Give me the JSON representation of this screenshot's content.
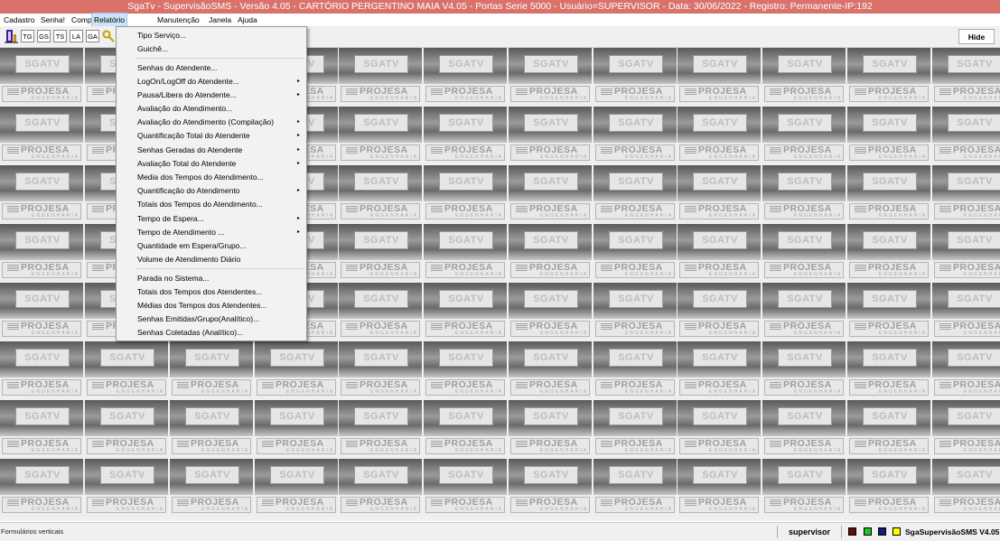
{
  "window": {
    "title": "SgaTv - SupervisãoSMS - Versão 4.05 - CARTÓRIO PERGENTINO MAIA V4.05 - Portas Serie 5000 - Usuário=SUPERVISOR  - Data: 30/06/2022 - Registro: Permanente-IP:192"
  },
  "menubar": {
    "items": [
      "Cadastro",
      "Senha!",
      "Compilação",
      "Relatório",
      "Manutenção",
      "Janela",
      "Ajuda"
    ],
    "active": "Relatório"
  },
  "toolbar": {
    "buttons": [
      "TG",
      "GS",
      "TS",
      "LA",
      "GA"
    ],
    "hide_label": "Hide"
  },
  "tile": {
    "label": "SGATV",
    "logo_text": "PROJESA",
    "logo_sub": "ENGENHARIA"
  },
  "dropdown": {
    "items": [
      {
        "label": "Tipo Serviço...",
        "submenu": false
      },
      {
        "label": "Guichê...",
        "submenu": false
      },
      {
        "label": "Senhas do Atendente...",
        "submenu": false
      },
      {
        "label": "LogOn/LogOff do Atendente...",
        "submenu": true
      },
      {
        "label": "Pausa/Libera do Atendente...",
        "submenu": true
      },
      {
        "label": "Avaliação do Atendimento...",
        "submenu": false
      },
      {
        "label": "Avaliação do Atendimento (Compilação)",
        "submenu": true
      },
      {
        "label": "Quantificação Total do Atendente",
        "submenu": true
      },
      {
        "label": "Senhas Geradas do Atendente",
        "submenu": true
      },
      {
        "label": "Avaliação Total do Atendente",
        "submenu": true
      },
      {
        "label": "Media dos Tempos do Atendimento...",
        "submenu": false
      },
      {
        "label": "Quantificação do Atendimento",
        "submenu": true
      },
      {
        "label": "Totais dos Tempos do  Atendimento...",
        "submenu": false
      },
      {
        "label": "Tempo de Espera...",
        "submenu": true
      },
      {
        "label": "Tempo de Atendimento ...",
        "submenu": true
      },
      {
        "label": "Quantidade em Espera/Grupo...",
        "submenu": false
      },
      {
        "label": "Volume de Atendimento Diário",
        "submenu": false
      },
      {
        "label": "Parada no Sistema...",
        "submenu": false
      },
      {
        "label": "Totais dos Tempos dos Atendentes...",
        "submenu": false
      },
      {
        "label": "Médias dos Tempos dos Atendentes...",
        "submenu": false
      },
      {
        "label": "Senhas Emitidas/Grupo(Analítico)...",
        "submenu": false
      },
      {
        "label": "Senhas Coletadas (Analítico)...",
        "submenu": false
      }
    ],
    "submenu_arrow": "▸"
  },
  "statusbar": {
    "left_text": "Formulários verticais",
    "user": "supervisor",
    "app_version": "SgaSupervisãoSMS V4.05",
    "leds": [
      {
        "name": "led-darkred",
        "color": "#5a1010"
      },
      {
        "name": "led-green",
        "color": "#22c022"
      },
      {
        "name": "led-navy",
        "color": "#1a1a6e"
      },
      {
        "name": "led-yellow",
        "color": "#ffff00"
      }
    ]
  }
}
